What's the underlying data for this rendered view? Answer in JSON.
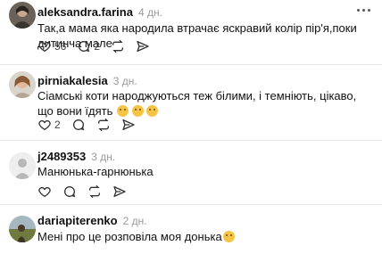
{
  "comments": [
    {
      "username": "aleksandra.farina",
      "time": "4 дн.",
      "text": "Так,а мама яка народила втрачає яскравий колір пір'я,поки дитинча мале",
      "likes": "56",
      "replies": "2"
    },
    {
      "username": "pirniakalesia",
      "time": "3 дн.",
      "text": "Сіамські коти народжуються теж білими, і темніють, цікаво, що вони їдять",
      "likes": "2",
      "replies": ""
    },
    {
      "username": "j2489353",
      "time": "3 дн.",
      "text": "Манюнька-гарнюнька",
      "likes": "",
      "replies": ""
    },
    {
      "username": "dariapiterenko",
      "time": "2 дн.",
      "text": "Мені про це розповіла моя донька",
      "likes": "",
      "replies": ""
    }
  ],
  "icons": {
    "like": "heart-icon",
    "reply": "comment-icon",
    "repost": "repost-icon",
    "share": "share-icon",
    "more": "more-icon",
    "emoji_laugh": "laughing-emoji-icon",
    "emoji_smile": "smiling-emoji-icon"
  },
  "colors": {
    "divider": "#e6e6e6",
    "muted": "#9a9a9a",
    "emoji": "#f6c445"
  }
}
